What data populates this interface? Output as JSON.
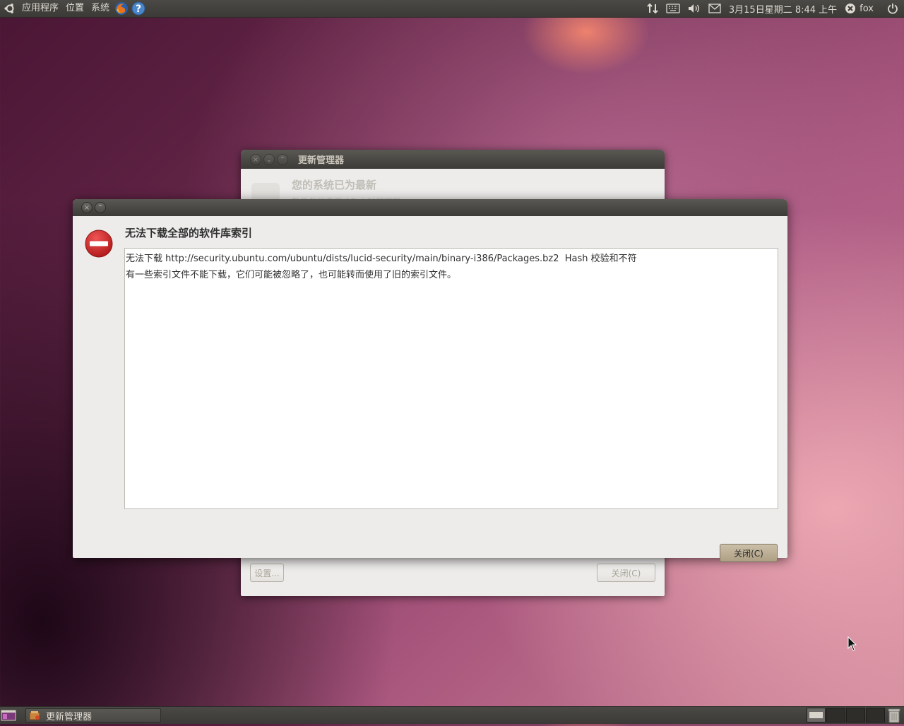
{
  "top_panel": {
    "menus": [
      "应用程序",
      "位置",
      "系统"
    ],
    "clock": "3月15日星期二  8:44 上午",
    "user": "fox",
    "launchers": [
      "firefox-icon",
      "help-icon"
    ],
    "indicators": [
      "network-icon",
      "keyboard-icon",
      "volume-icon",
      "mail-icon"
    ]
  },
  "bg_window": {
    "title": "更新管理器",
    "heading": "您的系统已为最新",
    "subtitle": "软件包信息于 15 小时前更新。",
    "settings_button": "设置...",
    "close_button": "关闭(C)"
  },
  "dialog": {
    "title": "无法下载全部的软件库索引",
    "details_lines": [
      "无法下载 http://security.ubuntu.com/ubuntu/dists/lucid-security/main/binary-i386/Packages.bz2  Hash 校验和不符",
      "有一些索引文件不能下载，它们可能被忽略了，也可能转而使用了旧的索引文件。"
    ],
    "close_button": "关闭(C)",
    "icon": "error-icon"
  },
  "bottom_panel": {
    "task": "更新管理器",
    "workspaces": 4,
    "active_workspace": 1
  },
  "colors": {
    "panel": "#3c3b37",
    "accent_button": "#bcae94",
    "error_red": "#cc2a2a"
  }
}
